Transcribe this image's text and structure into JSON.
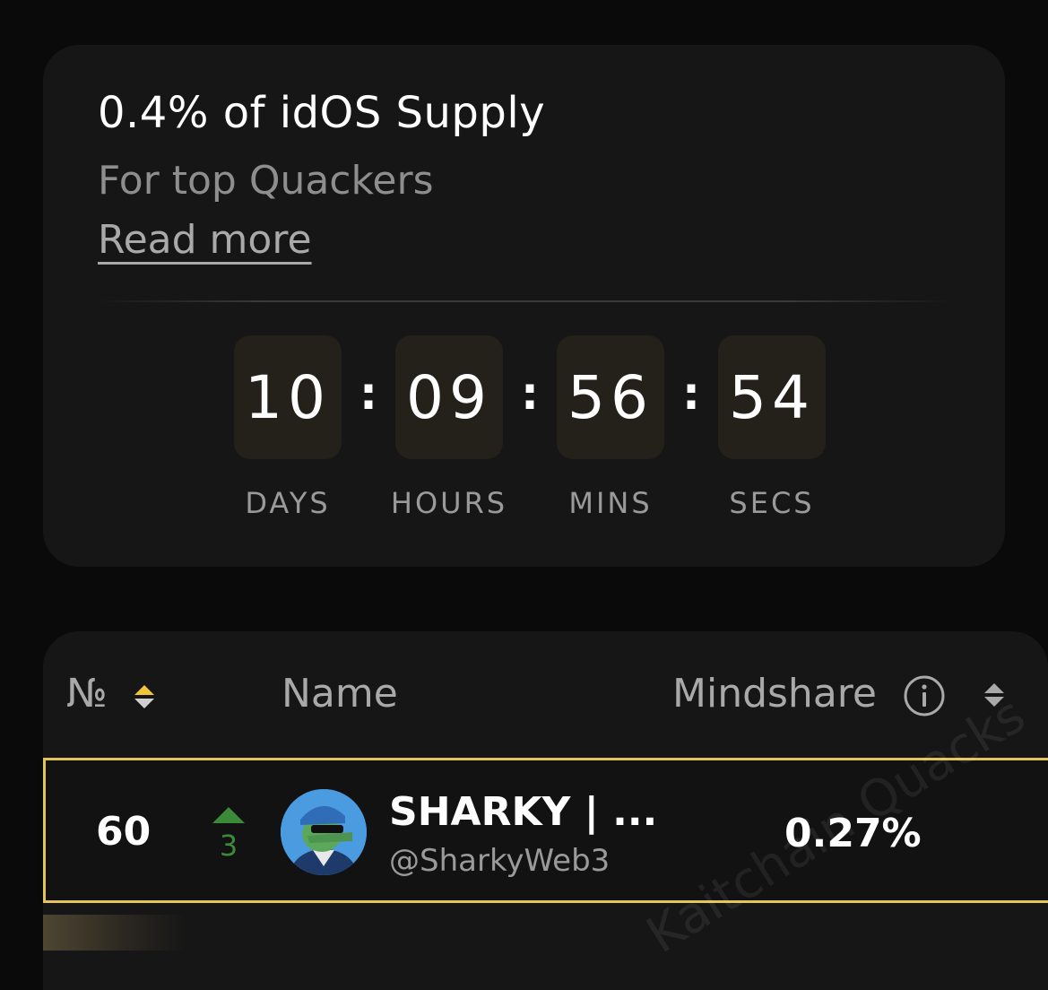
{
  "promo": {
    "title": "0.4% of idOS Supply",
    "subtitle": "For top Quackers",
    "read_more": "Read more"
  },
  "countdown": {
    "days": "10",
    "hours": "09",
    "mins": "56",
    "secs": "54",
    "separator": ":",
    "labels": {
      "days": "DAYS",
      "hours": "HOURS",
      "mins": "MINS",
      "secs": "SECS"
    }
  },
  "leaderboard": {
    "headers": {
      "number": "№",
      "name": "Name",
      "mindshare": "Mindshare"
    },
    "rows": [
      {
        "rank": "60",
        "change": "3",
        "name": "SHARKY | ...",
        "handle": "@SharkyWeb3",
        "mindshare": "0.27%"
      }
    ],
    "watermark": "Kaitchain Quacks"
  },
  "colors": {
    "accent": "#e3c45a",
    "up": "#3a8a3a",
    "card": "#161616",
    "background": "#0a0a0a"
  }
}
